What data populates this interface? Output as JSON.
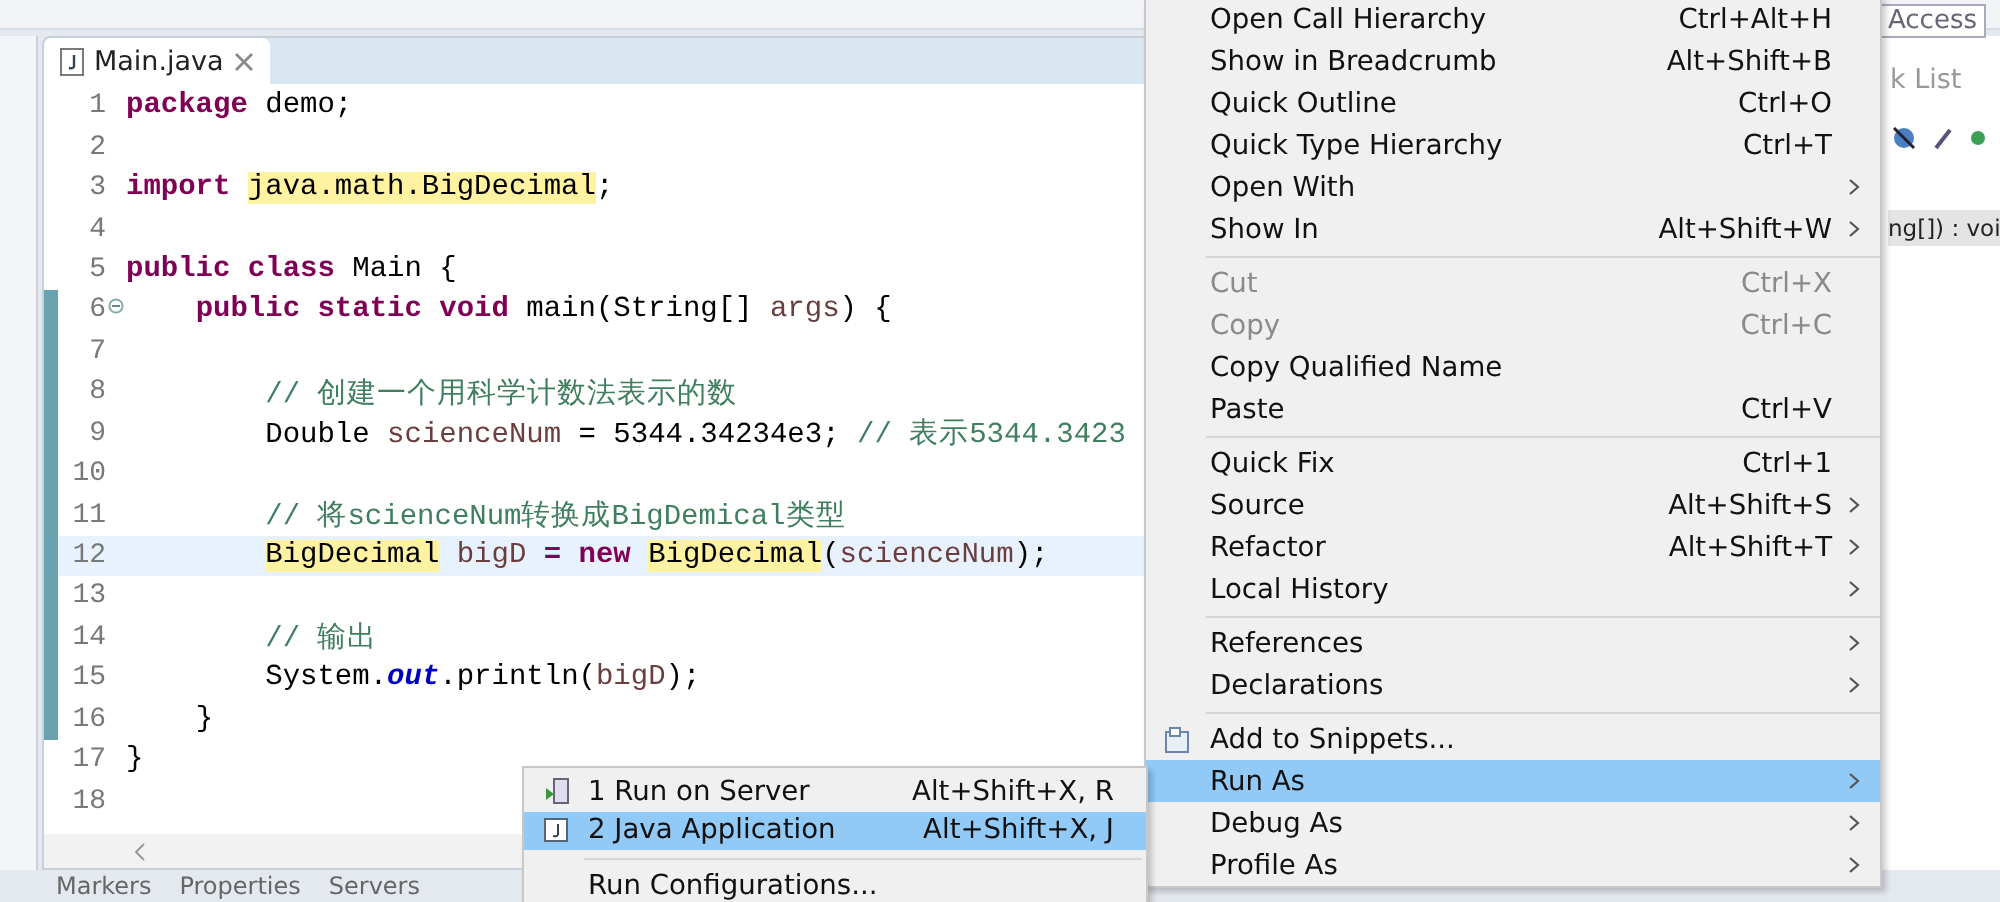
{
  "editor": {
    "tab": {
      "title": "Main.java",
      "selected": true
    },
    "lines": [
      {
        "num": "1",
        "current": false,
        "changed": false,
        "fold": false,
        "tokens": [
          {
            "kind": "kw",
            "text": "package "
          },
          {
            "kind": "text",
            "text": "demo;"
          }
        ]
      },
      {
        "num": "2",
        "current": false,
        "changed": false,
        "fold": false
      },
      {
        "num": "3",
        "current": false,
        "changed": false,
        "fold": false,
        "tokens": [
          {
            "kind": "kw",
            "text": "import "
          },
          {
            "kind": "hl",
            "text": "java.math.BigDecimal"
          },
          {
            "kind": "text",
            "text": ";"
          }
        ]
      },
      {
        "num": "4",
        "current": false,
        "changed": false,
        "fold": false
      },
      {
        "num": "5",
        "current": false,
        "changed": false,
        "fold": false,
        "tokens": [
          {
            "kind": "kw",
            "text": "public class "
          },
          {
            "kind": "text",
            "text": "Main {"
          }
        ]
      },
      {
        "num": "6",
        "current": false,
        "changed": true,
        "fold": true,
        "tokens": [
          {
            "kind": "kw",
            "text": "    public static void "
          },
          {
            "kind": "text",
            "text": "main(String[] "
          },
          {
            "kind": "var",
            "text": "args"
          },
          {
            "kind": "text",
            "text": ") {"
          }
        ]
      },
      {
        "num": "7",
        "current": false,
        "changed": true,
        "fold": false
      },
      {
        "num": "8",
        "current": false,
        "changed": true,
        "fold": false,
        "tokens": [
          {
            "kind": "comment",
            "text": "        // 创建一个用科学计数法表示的数"
          }
        ]
      },
      {
        "num": "9",
        "current": false,
        "changed": true,
        "fold": false,
        "tokens": [
          {
            "kind": "text",
            "text": "        Double "
          },
          {
            "kind": "var",
            "text": "scienceNum"
          },
          {
            "kind": "text",
            "text": " = 5344.34234e3; "
          },
          {
            "kind": "comment",
            "text": "// 表示5344.3423"
          }
        ]
      },
      {
        "num": "10",
        "current": false,
        "changed": true,
        "fold": false
      },
      {
        "num": "11",
        "current": false,
        "changed": true,
        "fold": false,
        "tokens": [
          {
            "kind": "comment",
            "text": "        // 将scienceNum转换成BigDemical类型"
          }
        ]
      },
      {
        "num": "12",
        "current": true,
        "changed": true,
        "fold": false,
        "tokens": [
          {
            "kind": "hl",
            "text": "        BigDecimal"
          },
          {
            "kind": "var",
            "text": " bigD"
          },
          {
            "kind": "kw",
            "text": " = new "
          },
          {
            "kind": "hl",
            "text": "BigDecimal"
          },
          {
            "kind": "text",
            "text": "("
          },
          {
            "kind": "var",
            "text": "scienceNum"
          },
          {
            "kind": "text",
            "text": ");"
          }
        ]
      },
      {
        "num": "13",
        "current": false,
        "changed": true,
        "fold": false
      },
      {
        "num": "14",
        "current": false,
        "changed": true,
        "fold": false,
        "tokens": [
          {
            "kind": "comment",
            "text": "        // 输出"
          }
        ]
      },
      {
        "num": "15",
        "current": false,
        "changed": true,
        "fold": false,
        "tokens": [
          {
            "kind": "text",
            "text": "        System."
          },
          {
            "kind": "field",
            "text": "out"
          },
          {
            "kind": "text",
            "text": ".println("
          },
          {
            "kind": "var",
            "text": "bigD"
          },
          {
            "kind": "text",
            "text": ");"
          }
        ]
      },
      {
        "num": "16",
        "current": false,
        "changed": true,
        "fold": false,
        "tokens": [
          {
            "kind": "text",
            "text": "    }"
          }
        ]
      },
      {
        "num": "17",
        "current": false,
        "changed": false,
        "fold": false,
        "tokens": [
          {
            "kind": "text",
            "text": "}"
          }
        ]
      },
      {
        "num": "18",
        "current": false,
        "changed": false,
        "fold": false
      }
    ]
  },
  "side_panel": {
    "field_value": "Access",
    "tab_label": "k List",
    "outline_row": "ng[]) : voi"
  },
  "bottom_tabs": [
    {
      "label": "Markers"
    },
    {
      "label": "Properties"
    },
    {
      "label": "Servers"
    }
  ],
  "context_menu": [
    {
      "kind": "item",
      "label": "Open Call Hierarchy",
      "shortcut": "Ctrl+Alt+H",
      "submenu": false,
      "disabled": false,
      "selected": false
    },
    {
      "kind": "item",
      "label": "Show in Breadcrumb",
      "shortcut": "Alt+Shift+B",
      "submenu": false,
      "disabled": false,
      "selected": false
    },
    {
      "kind": "item",
      "label": "Quick Outline",
      "shortcut": "Ctrl+O",
      "submenu": false,
      "disabled": false,
      "selected": false
    },
    {
      "kind": "item",
      "label": "Quick Type Hierarchy",
      "shortcut": "Ctrl+T",
      "submenu": false,
      "disabled": false,
      "selected": false
    },
    {
      "kind": "item",
      "label": "Open With",
      "submenu": true,
      "disabled": false,
      "selected": false
    },
    {
      "kind": "item",
      "label": "Show In",
      "shortcut": "Alt+Shift+W",
      "submenu": true,
      "disabled": false,
      "selected": false
    },
    {
      "kind": "separator"
    },
    {
      "kind": "item",
      "label": "Cut",
      "shortcut": "Ctrl+X",
      "submenu": false,
      "disabled": true,
      "selected": false
    },
    {
      "kind": "item",
      "label": "Copy",
      "shortcut": "Ctrl+C",
      "submenu": false,
      "disabled": true,
      "selected": false
    },
    {
      "kind": "item",
      "label": "Copy Qualified Name",
      "submenu": false,
      "disabled": false,
      "selected": false
    },
    {
      "kind": "item",
      "label": "Paste",
      "shortcut": "Ctrl+V",
      "submenu": false,
      "disabled": false,
      "selected": false
    },
    {
      "kind": "separator"
    },
    {
      "kind": "item",
      "label": "Quick Fix",
      "shortcut": "Ctrl+1",
      "submenu": false,
      "disabled": false,
      "selected": false
    },
    {
      "kind": "item",
      "label": "Source",
      "shortcut": "Alt+Shift+S",
      "submenu": true,
      "disabled": false,
      "selected": false
    },
    {
      "kind": "item",
      "label": "Refactor",
      "shortcut": "Alt+Shift+T",
      "submenu": true,
      "disabled": false,
      "selected": false
    },
    {
      "kind": "item",
      "label": "Local History",
      "submenu": true,
      "disabled": false,
      "selected": false
    },
    {
      "kind": "separator"
    },
    {
      "kind": "item",
      "label": "References",
      "submenu": true,
      "disabled": false,
      "selected": false
    },
    {
      "kind": "item",
      "label": "Declarations",
      "submenu": true,
      "disabled": false,
      "selected": false
    },
    {
      "kind": "separator"
    },
    {
      "kind": "item",
      "label": "Add to Snippets...",
      "submenu": false,
      "disabled": false,
      "selected": false
    },
    {
      "kind": "item",
      "label": "Run As",
      "submenu": true,
      "disabled": false,
      "selected": true
    },
    {
      "kind": "item",
      "label": "Debug As",
      "submenu": true,
      "disabled": false,
      "selected": false
    },
    {
      "kind": "item",
      "label": "Profile As",
      "submenu": true,
      "disabled": false,
      "selected": false
    }
  ],
  "run_as_submenu": [
    {
      "kind": "item",
      "label": "1 Run on Server",
      "shortcut": "Alt+Shift+X, R",
      "selected": false
    },
    {
      "kind": "item",
      "label": "2 Java Application",
      "shortcut": "Alt+Shift+X, J",
      "selected": true
    },
    {
      "kind": "separator"
    },
    {
      "kind": "item",
      "label": "Run Configurations...",
      "selected": false
    }
  ]
}
